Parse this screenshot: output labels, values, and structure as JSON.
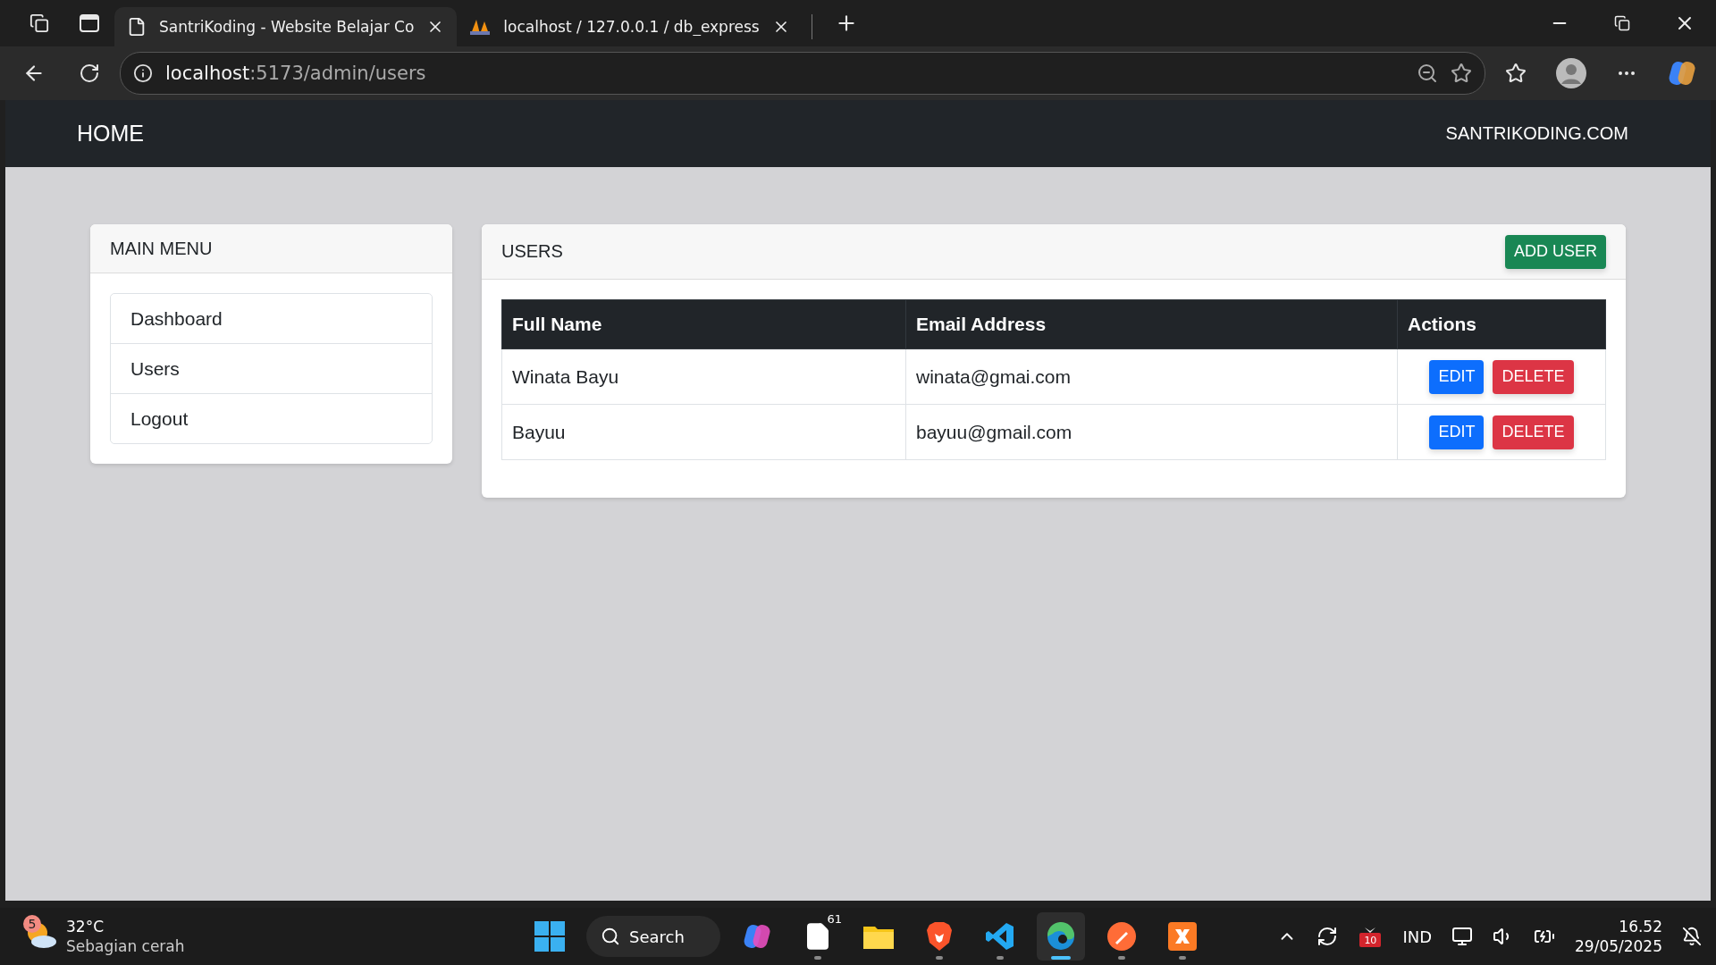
{
  "browser": {
    "tabs": [
      {
        "title": "SantriKoding - Website Belajar Co",
        "kind": "page",
        "selected": true
      },
      {
        "title": "localhost / 127.0.0.1 / db_express",
        "kind": "pma",
        "selected": false
      }
    ],
    "url": {
      "host": "localhost",
      "path": ":5173/admin/users"
    }
  },
  "navbar": {
    "brand": "HOME",
    "link": "SANTRIKODING.COM"
  },
  "menu": {
    "title": "MAIN MENU",
    "items": [
      {
        "label": "Dashboard"
      },
      {
        "label": "Users"
      },
      {
        "label": "Logout"
      }
    ]
  },
  "users": {
    "title": "USERS",
    "add_button": "ADD USER",
    "columns": [
      "Full Name",
      "Email Address",
      "Actions"
    ],
    "rows": [
      {
        "full_name": "Winata Bayu",
        "email": "winata@gmai.com",
        "edit": "EDIT",
        "delete": "DELETE"
      },
      {
        "full_name": "Bayuu",
        "email": "bayuu@gmail.com",
        "edit": "EDIT",
        "delete": "DELETE"
      }
    ]
  },
  "taskbar": {
    "weather": {
      "badge": "5",
      "temp": "32°C",
      "condition": "Sebagian cerah"
    },
    "search": "Search",
    "apps": [
      {
        "kind": "copilot",
        "running": false,
        "selected": false
      },
      {
        "kind": "notepad",
        "badge": "61",
        "running": true,
        "selected": false
      },
      {
        "kind": "explorer",
        "running": false,
        "selected": false
      },
      {
        "kind": "brave",
        "running": true,
        "selected": false
      },
      {
        "kind": "vscode",
        "running": true,
        "selected": false
      },
      {
        "kind": "edge",
        "running": true,
        "selected": true
      },
      {
        "kind": "postman",
        "running": true,
        "selected": false
      },
      {
        "kind": "xampp",
        "running": true,
        "selected": false
      }
    ],
    "tray": {
      "calendar_badge": "10",
      "language": "IND",
      "time": "16.52",
      "date": "29/05/2025"
    }
  }
}
